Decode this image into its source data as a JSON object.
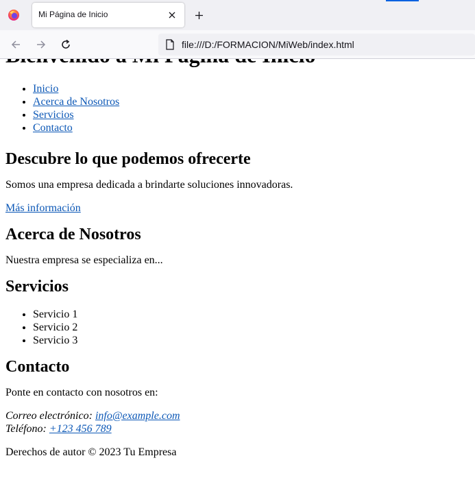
{
  "browser": {
    "tab_title": "Mi Página de Inicio",
    "url": "file:///D:/FORMACION/MiWeb/index.html",
    "accent_color": "#0061e0",
    "icons": [
      "firefox-logo-icon",
      "close-icon",
      "plus-icon",
      "back-arrow-icon",
      "forward-arrow-icon",
      "reload-icon",
      "page-icon"
    ]
  },
  "page": {
    "title": "Bienvenido a Mi Página de Inicio",
    "nav": [
      {
        "label": "Inicio"
      },
      {
        "label": "Acerca de Nosotros"
      },
      {
        "label": "Servicios"
      },
      {
        "label": "Contacto"
      }
    ],
    "hero": {
      "heading": "Descubre lo que podemos ofrecerte",
      "text": "Somos una empresa dedicada a brindarte soluciones innovadoras.",
      "link": "Más información"
    },
    "about": {
      "heading": "Acerca de Nosotros",
      "text": "Nuestra empresa se especializa en..."
    },
    "services": {
      "heading": "Servicios",
      "items": [
        "Servicio 1",
        "Servicio 2",
        "Servicio 3"
      ]
    },
    "contact": {
      "heading": "Contacto",
      "intro": "Ponte en contacto con nosotros en:",
      "email_label": "Correo electrónico:",
      "email": "info@example.com",
      "phone_label": "Teléfono:",
      "phone": "+123 456 789"
    },
    "footer": "Derechos de autor © 2023 Tu Empresa",
    "link_color": "#0b57b6"
  }
}
